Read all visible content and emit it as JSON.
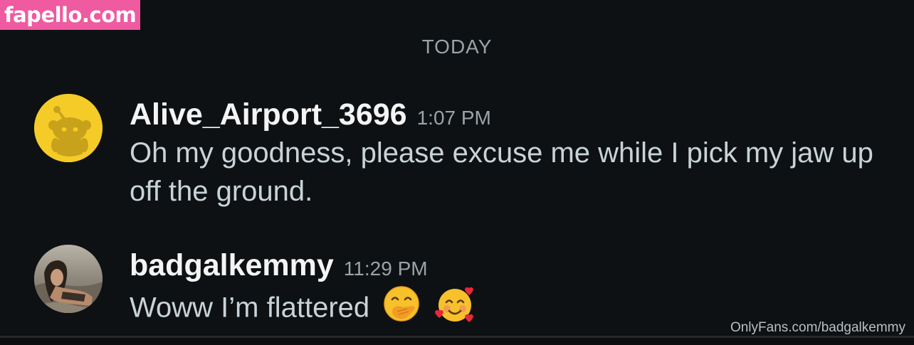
{
  "watermark_top": "fapello.com",
  "date_divider": "TODAY",
  "messages": [
    {
      "username": "Alive_Airport_3696",
      "time": "1:07 PM",
      "text": "Oh my goodness, please excuse me while I pick my jaw up off the ground.",
      "avatar_icon": "reddit-snoo-avatar-icon",
      "avatar_color": "#f5cc27"
    },
    {
      "username": "badgalkemmy",
      "time": "11:29 PM",
      "text": "Woww I’m flattered",
      "emojis": [
        "face-with-hand-over-mouth-emoji",
        "smiling-face-with-hearts-emoji"
      ],
      "avatar_icon": "user-photo-avatar"
    }
  ],
  "watermark_bottom": "OnlyFans.com/badgalkemmy",
  "colors": {
    "background": "#0e1113",
    "username": "#f4f4f4",
    "message_text": "#c8d3d9",
    "meta_text": "#9aa3a8",
    "watermark_pink": "#ef5aa0"
  }
}
